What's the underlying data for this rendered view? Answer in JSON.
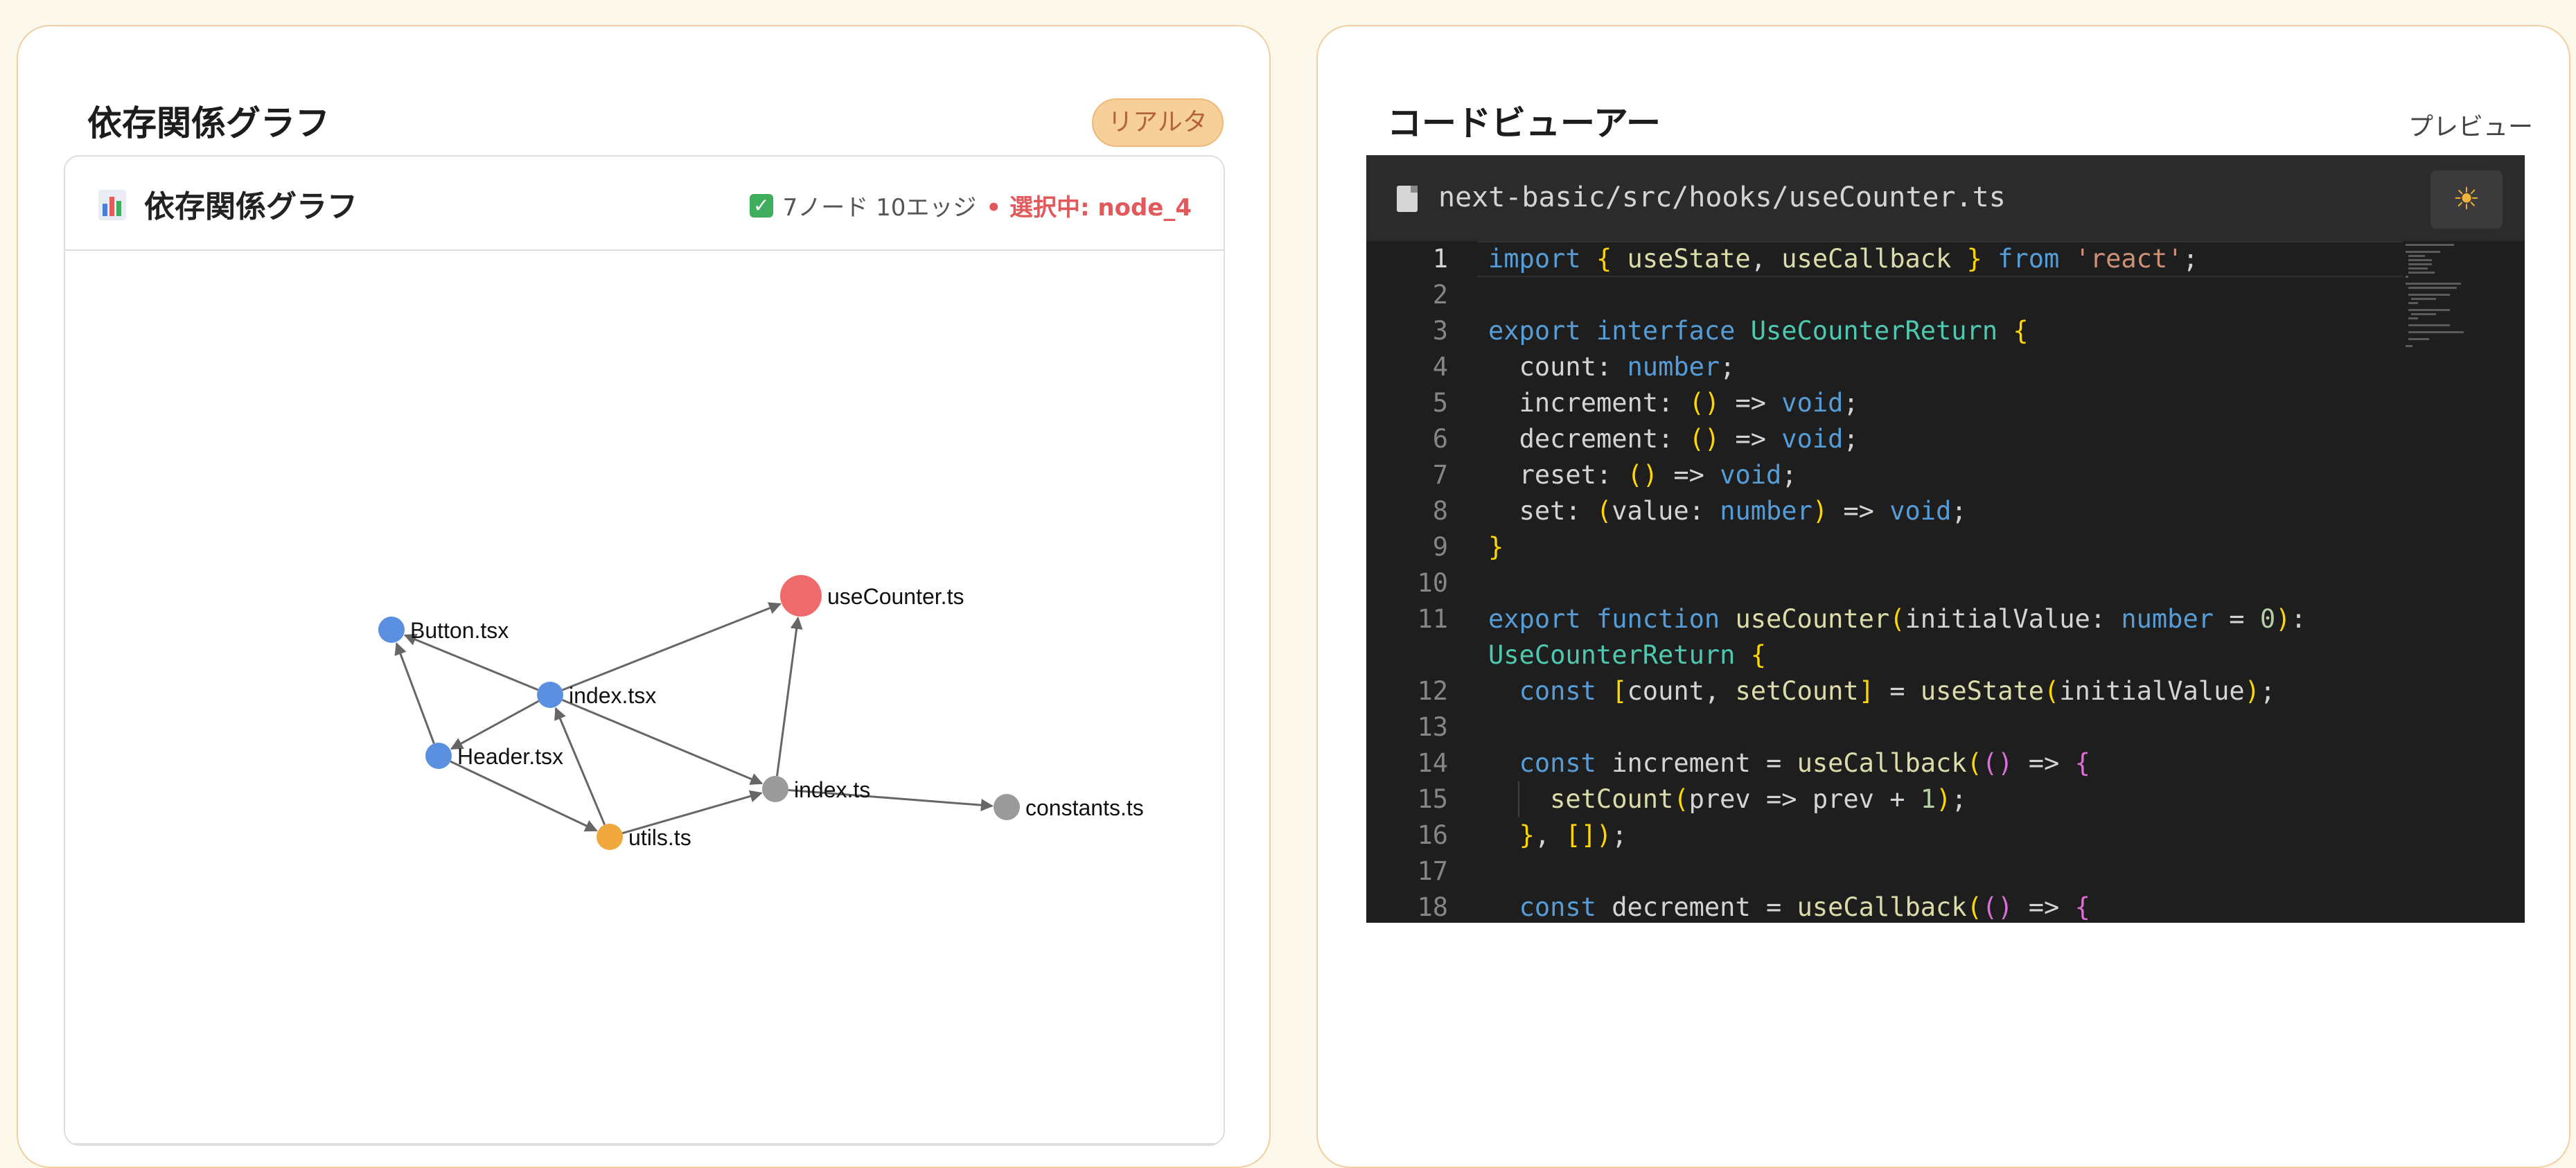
{
  "left_panel": {
    "title": "依存関係グラフ",
    "badge": "リアルタイム",
    "card": {
      "icon": "bar-chart-icon",
      "title": "依存関係グラフ",
      "stats": "7ノード 10エッジ",
      "selected": "• 選択中: node_4"
    },
    "graph": {
      "nodes": [
        {
          "id": "button",
          "label": "Button.tsx",
          "color": "#5b8fe0"
        },
        {
          "id": "index_tsx",
          "label": "index.tsx",
          "color": "#5b8fe0"
        },
        {
          "id": "header",
          "label": "Header.tsx",
          "color": "#5b8fe0"
        },
        {
          "id": "utils",
          "label": "utils.ts",
          "color": "#f0a73c"
        },
        {
          "id": "index_ts",
          "label": "index.ts",
          "color": "#9a9a9a"
        },
        {
          "id": "constants",
          "label": "constants.ts",
          "color": "#9a9a9a"
        },
        {
          "id": "usecounter",
          "label": "useCounter.ts",
          "color": "#ef6b6b"
        }
      ],
      "edges": [
        [
          "index_tsx",
          "button"
        ],
        [
          "index_tsx",
          "header"
        ],
        [
          "index_tsx",
          "usecounter"
        ],
        [
          "index_tsx",
          "index_ts"
        ],
        [
          "header",
          "button"
        ],
        [
          "header",
          "utils"
        ],
        [
          "utils",
          "index_tsx"
        ],
        [
          "utils",
          "index_ts"
        ],
        [
          "index_ts",
          "usecounter"
        ],
        [
          "index_ts",
          "constants"
        ]
      ]
    }
  },
  "right_panel": {
    "title": "コードビューアー",
    "preview_label": "プレビュー",
    "file_path": "next-basic/src/hooks/useCounter.ts",
    "theme_icon": "sun-icon",
    "line_numbers": [
      "1",
      "2",
      "3",
      "4",
      "5",
      "6",
      "7",
      "8",
      "9",
      "10",
      "11",
      "",
      "12",
      "13",
      "14",
      "15",
      "16",
      "17",
      "18"
    ],
    "code_lines": [
      "import { useState, useCallback } from 'react';",
      "",
      "export interface UseCounterReturn {",
      "  count: number;",
      "  increment: () => void;",
      "  decrement: () => void;",
      "  reset: () => void;",
      "  set: (value: number) => void;",
      "}",
      "",
      "export function useCounter(initialValue: number = 0):",
      "UseCounterReturn {",
      "  const [count, setCount] = useState(initialValue);",
      "",
      "  const increment = useCallback(() => {",
      "    setCount(prev => prev + 1);",
      "  }, []);",
      "",
      "  const decrement = useCallback(() => {"
    ]
  }
}
